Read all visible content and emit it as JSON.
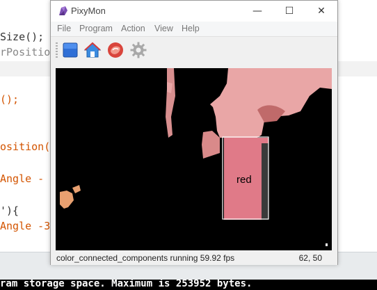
{
  "editor": {
    "lines": [
      {
        "text": "Size();",
        "color": "#333333"
      },
      {
        "text": "rPositio",
        "color": "#888888"
      },
      {
        "text": "();",
        "color": "#d35400"
      },
      {
        "text": "osition(",
        "color": "#d35400"
      },
      {
        "text": "Angle - ",
        "color": "#d35400"
      },
      {
        "text": "'){",
        "color": "#333333"
      },
      {
        "text": "Angle -3",
        "color": "#d35400"
      }
    ]
  },
  "console": {
    "text": "ram storage space. Maximum is 253952 bytes."
  },
  "window": {
    "title": "PixyMon",
    "controls": {
      "minimize": "—",
      "maximize": "☐",
      "close": "✕"
    }
  },
  "menu": [
    "File",
    "Program",
    "Action",
    "View",
    "Help"
  ],
  "toolbar": [
    {
      "icon": "stop-square-icon",
      "color": "#2f6fd6"
    },
    {
      "icon": "home-icon",
      "color": "#3a8be0"
    },
    {
      "icon": "raw-video-icon",
      "color": "#d9453c"
    },
    {
      "icon": "gear-icon",
      "color": "#a8a8a8"
    }
  ],
  "video": {
    "block_label": "red",
    "block_color": "#e07a88"
  },
  "status": {
    "program": "color_connected_components running 59.92 fps",
    "coords": "62, 50"
  }
}
